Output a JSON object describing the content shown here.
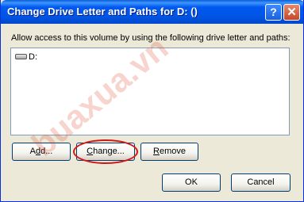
{
  "window": {
    "title": "Change Drive Letter and Paths for D: ()",
    "help_glyph": "?",
    "close_glyph": "✕"
  },
  "instruction": "Allow access to this volume by using the following drive letter and paths:",
  "list": {
    "items": [
      {
        "icon": "drive-icon",
        "label": "D:"
      }
    ]
  },
  "buttons": {
    "add": {
      "pre": "A",
      "accel": "d",
      "post": "d..."
    },
    "change": {
      "pre": "",
      "accel": "C",
      "post": "hange..."
    },
    "remove": {
      "pre": "",
      "accel": "R",
      "post": "emove"
    },
    "ok": {
      "label": "OK"
    },
    "cancel": {
      "label": "Cancel"
    }
  },
  "watermark": "buaxua.vn",
  "colors": {
    "titlebar": "#0055E5",
    "dialog_bg": "#ECE9D8",
    "highlight": "#D01818"
  }
}
